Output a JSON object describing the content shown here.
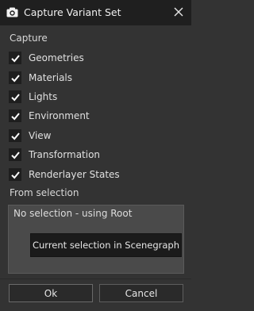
{
  "window": {
    "title": "Capture Variant Set",
    "icon": "camera-icon",
    "close_icon": "close-icon"
  },
  "capture": {
    "heading": "Capture",
    "options": [
      {
        "label": "Geometries",
        "checked": true
      },
      {
        "label": "Materials",
        "checked": true
      },
      {
        "label": "Lights",
        "checked": true
      },
      {
        "label": "Environment",
        "checked": true
      },
      {
        "label": "View",
        "checked": true
      },
      {
        "label": "Transformation",
        "checked": true
      },
      {
        "label": "Renderlayer States",
        "checked": true
      }
    ]
  },
  "from_selection": {
    "heading": "From selection",
    "status": "No selection - using Root",
    "button_label": "Current selection in Scenegraph"
  },
  "buttons": {
    "ok": "Ok",
    "cancel": "Cancel"
  },
  "colors": {
    "titlebar": "#1f1f1f",
    "background": "#333333",
    "selection_panel": "#4a4a4a",
    "checkbox": "#1e1e1e"
  }
}
